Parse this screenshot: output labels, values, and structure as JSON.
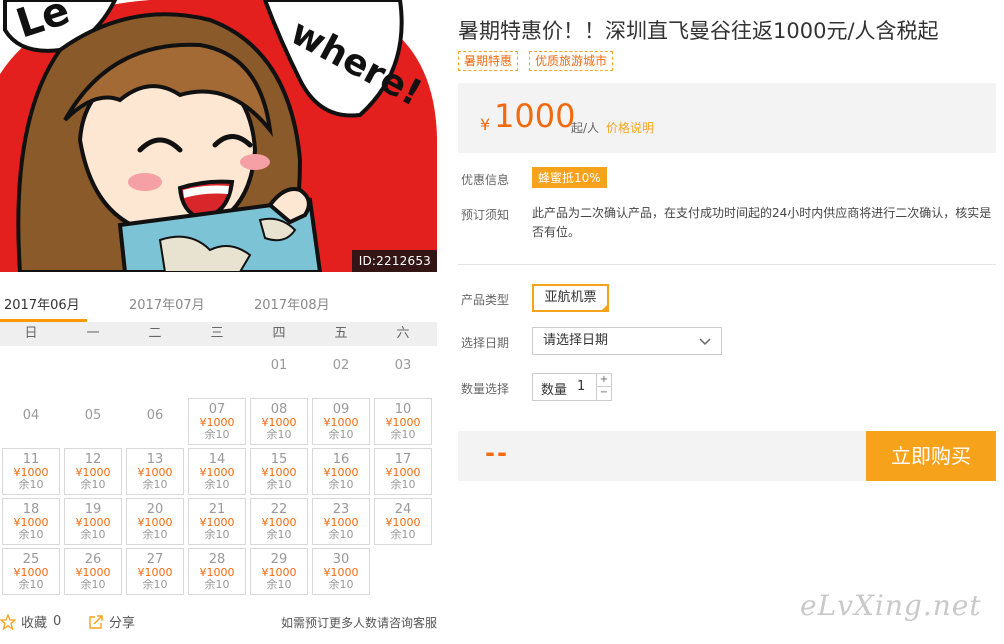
{
  "hero": {
    "image_id": "ID:2212653",
    "banner_text_left": "Le",
    "banner_text_right": "where!"
  },
  "months": [
    "2017年06月",
    "2017年07月",
    "2017年08月"
  ],
  "calendar": {
    "weekdays": [
      "日",
      "一",
      "二",
      "三",
      "四",
      "五",
      "六"
    ],
    "empty_days": [
      "01",
      "02",
      "03",
      "04",
      "05",
      "06"
    ],
    "available_days": [
      "07",
      "08",
      "09",
      "10",
      "11",
      "12",
      "13",
      "14",
      "15",
      "16",
      "17",
      "18",
      "19",
      "20",
      "21",
      "22",
      "23",
      "24",
      "25",
      "26",
      "27",
      "28",
      "29",
      "30"
    ],
    "price_label": "¥1000",
    "remaining_label": "余10"
  },
  "actions": {
    "favorite_label": "收藏",
    "favorite_count": "0",
    "share_label": "分享",
    "advice": "如需预订更多人数请咨询客服"
  },
  "product": {
    "title": "暑期特惠价！！深圳直飞曼谷往返1000元/人含税起",
    "tags": [
      "暑期特惠",
      "优质旅游城市"
    ],
    "price_symbol": "¥",
    "price": "1000",
    "price_unit": "起/人",
    "price_note_link": "价格说明",
    "promo_label": "优惠信息",
    "promo_badge": "蜂蜜抵10%",
    "notice_label": "预订须知",
    "notice_text": "此产品为二次确认产品，在支付成功时间起的24小时内供应商将进行二次确认，核实是否有位。",
    "type_label": "产品类型",
    "type_option": "亚航机票",
    "date_label": "选择日期",
    "date_placeholder": "请选择日期",
    "qty_label_row": "数量选择",
    "qty_label": "数量",
    "qty_value": "1",
    "total": "--",
    "buy_label": "立即购买"
  },
  "watermark": "eLvXing.net",
  "colors": {
    "accent": "#f7a21b",
    "price": "#f26a10"
  }
}
